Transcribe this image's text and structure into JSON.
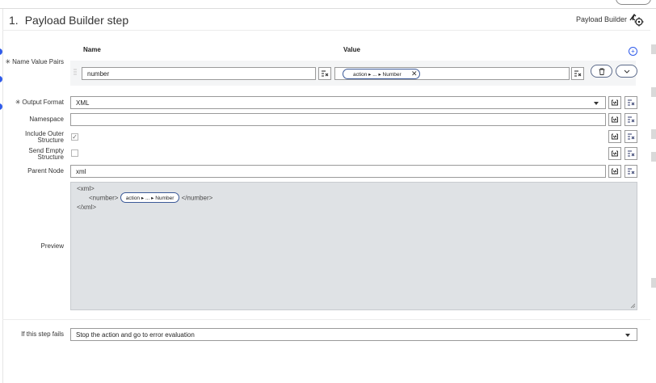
{
  "header": {
    "step_number": "1.",
    "title": "Payload Builder step",
    "type_label": "Payload Builder",
    "type_icon": "payload-builder-icon"
  },
  "columns": {
    "name": "Name",
    "value": "Value"
  },
  "name_value_pairs": {
    "label": "Name Value Pairs",
    "required": "✳",
    "rows": [
      {
        "name": "number",
        "value_pill": {
          "first": "action",
          "mid": "...",
          "last": "Number"
        }
      }
    ]
  },
  "output_format": {
    "label": "Output Format",
    "required": "✳",
    "value": "XML"
  },
  "namespace": {
    "label": "Namespace",
    "value": ""
  },
  "include_outer_structure": {
    "label_line1": "Include Outer",
    "label_line2": "Structure",
    "checked": true,
    "checkmark": "✓"
  },
  "send_empty_structure": {
    "label_line1": "Send Empty",
    "label_line2": "Structure",
    "checked": false
  },
  "parent_node": {
    "label": "Parent Node",
    "value": "xml"
  },
  "preview": {
    "label": "Preview",
    "line1": "<xml>",
    "line2_open": "<number>",
    "line2_pill": {
      "first": "action",
      "mid": "...",
      "last": "Number"
    },
    "line2_close": "</number>",
    "line3": "</xml>"
  },
  "on_failure": {
    "label": "If this step fails",
    "value": "Stop the action and go to error evaluation"
  },
  "colors": {
    "accent": "#2f5bea",
    "pill_border": "#3b5998",
    "preview_bg": "#dfe2e5"
  }
}
